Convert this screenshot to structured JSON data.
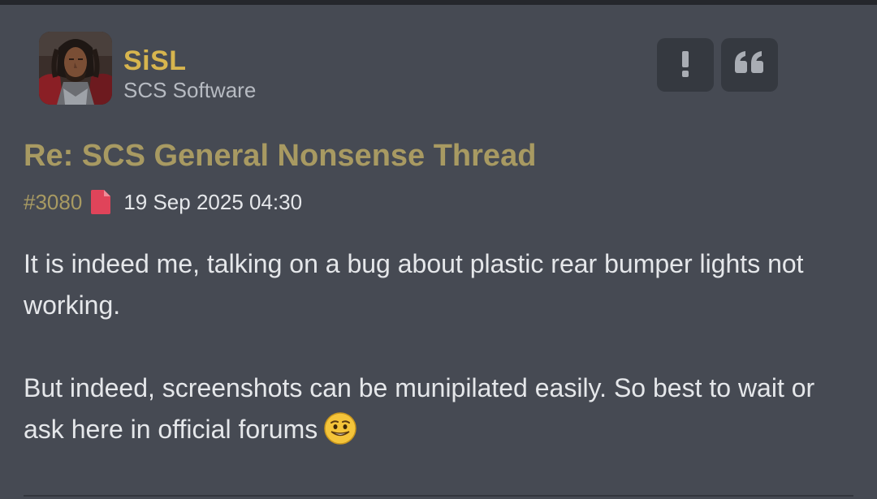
{
  "post": {
    "author": {
      "name": "SiSL",
      "title": "SCS Software"
    },
    "actions": {
      "report_label": "!",
      "report_icon": "exclamation-icon",
      "quote_icon": "quote-icon"
    },
    "title": "Re: SCS General Nonsense Thread",
    "number": "#3080",
    "post_icon": "document-icon",
    "timestamp": "19 Sep 2025 04:30",
    "body": {
      "paragraph_1": "It is indeed me, talking on a bug about plastic rear bumper lights not working.",
      "paragraph_2": "But indeed, screenshots can be munipilated easily. So best to wait or ask here in official forums",
      "emoji": "smile-emoji"
    }
  },
  "colors": {
    "background": "#464a53",
    "username": "#d7b54e",
    "title": "#a89a62",
    "text": "#e5e7ea",
    "muted": "#b7bbc2",
    "button": "#353940",
    "document_icon": "#e0445a"
  }
}
